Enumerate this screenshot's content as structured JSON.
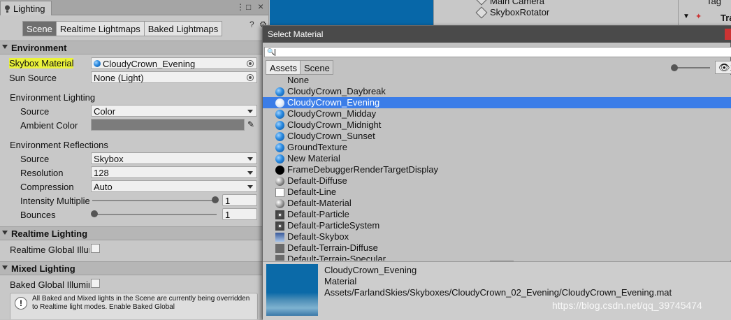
{
  "lighting": {
    "window_tab": "Lighting",
    "subtabs": [
      "Scene",
      "Realtime Lightmaps",
      "Baked Lightmaps"
    ],
    "active_subtab": 0,
    "environment": {
      "header": "Environment",
      "skybox_material_label": "Skybox Material",
      "skybox_material_value": "CloudyCrown_Evening",
      "sun_source_label": "Sun Source",
      "sun_source_value": "None (Light)",
      "env_lighting_header": "Environment Lighting",
      "source_label": "Source",
      "source_value": "Color",
      "ambient_color_label": "Ambient Color",
      "ambient_color": "#7c7c7c",
      "env_reflections_header": "Environment Reflections",
      "refl_source_label": "Source",
      "refl_source_value": "Skybox",
      "resolution_label": "Resolution",
      "resolution_value": "128",
      "compression_label": "Compression",
      "compression_value": "Auto",
      "intensity_label": "Intensity Multiplier",
      "intensity_value": "1",
      "bounces_label": "Bounces",
      "bounces_value": "1"
    },
    "realtime": {
      "header": "Realtime Lighting",
      "gi_label": "Realtime Global Illumination"
    },
    "mixed": {
      "header": "Mixed Lighting",
      "baked_gi_label": "Baked Global Illumination",
      "help_text": "All Baked and Mixed lights in the Scene are currently being overridden to Realtime light modes. Enable Baked Global"
    }
  },
  "hierarchy": {
    "items": [
      "Main Camera",
      "SkyboxRotator"
    ]
  },
  "inspector": {
    "tag_label": "Tag",
    "tra_label": "Tra"
  },
  "select_material": {
    "title": "Select Material",
    "search_value": "",
    "tabs": [
      "Assets",
      "Scene"
    ],
    "active_tab": 0,
    "hidden_count": "1",
    "items": [
      {
        "name": "None",
        "icon": "none"
      },
      {
        "name": "CloudyCrown_Daybreak",
        "icon": "sphere-blue"
      },
      {
        "name": "CloudyCrown_Evening",
        "icon": "sel-sphere"
      },
      {
        "name": "CloudyCrown_Midday",
        "icon": "sphere-blue"
      },
      {
        "name": "CloudyCrown_Midnight",
        "icon": "sphere-blue"
      },
      {
        "name": "CloudyCrown_Sunset",
        "icon": "sphere-blue"
      },
      {
        "name": "GroundTexture",
        "icon": "sphere-blue"
      },
      {
        "name": "New Material",
        "icon": "sphere-blue"
      },
      {
        "name": "FrameDebuggerRenderTargetDisplay",
        "icon": "sphere-black"
      },
      {
        "name": "Default-Diffuse",
        "icon": "sphere-grey"
      },
      {
        "name": "Default-Line",
        "icon": "square-white"
      },
      {
        "name": "Default-Material",
        "icon": "sphere-grey"
      },
      {
        "name": "Default-Particle",
        "icon": "sparkle"
      },
      {
        "name": "Default-ParticleSystem",
        "icon": "sparkle"
      },
      {
        "name": "Default-Skybox",
        "icon": "skybox"
      },
      {
        "name": "Default-Terrain-Diffuse",
        "icon": "grey-sq"
      },
      {
        "name": "Default-Terrain-Specular",
        "icon": "grey-sq"
      }
    ],
    "selected_index": 2,
    "preview": {
      "name": "CloudyCrown_Evening",
      "type": "Material",
      "path": "Assets/FarlandSkies/Skyboxes/CloudyCrown_02_Evening/CloudyCrown_Evening.mat"
    }
  },
  "watermark": "https://blog.csdn.net/qq_39745474"
}
